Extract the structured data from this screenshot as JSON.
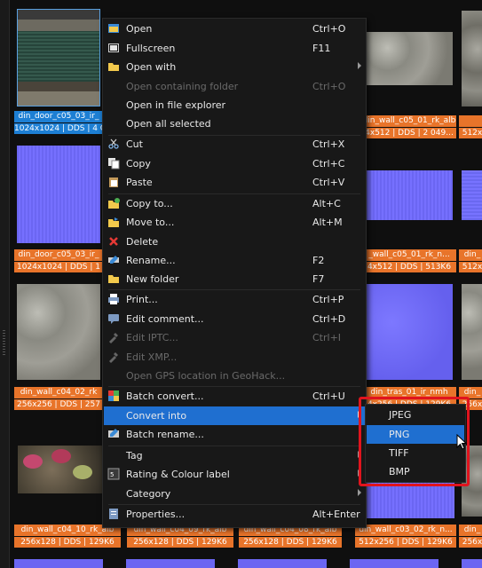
{
  "thumbnails": [
    {
      "name": "din_door_c05_03_ir_",
      "info": "1024x1024 | DDS | 4 C",
      "selected": true
    },
    {
      "name": "din_wall_c05_01_rk_alb",
      "info": "4x512 | DDS | 2 049..."
    },
    {
      "name": "",
      "info": "512x"
    },
    {
      "name": "din_door_c05_03_ir_",
      "info": "1024x1024 | DDS | 1"
    },
    {
      "name": "_wall_c05_01_rk_n...",
      "info": "4x512 | DDS | 513K6"
    },
    {
      "name": "din_",
      "info": "512x"
    },
    {
      "name": "din_wall_c04_02_rk",
      "info": "256x256 | DDS | 257"
    },
    {
      "name": "din_tras_01_ir_nmh",
      "info": "4x256 | DDS | 129K6"
    },
    {
      "name": "din_",
      "info": "256x"
    },
    {
      "name": "din_wall_c04_10_rk_alb",
      "info": "256x128 | DDS | 129K6"
    },
    {
      "name": "din_wall_c04_09_rk_alb",
      "info": "256x128 | DDS | 129K6"
    },
    {
      "name": "din_wall_c04_08_rk_alb",
      "info": "256x128 | DDS | 129K6"
    },
    {
      "name": "din_wall_c03_02_rk_n...",
      "info": "512x256 | DDS | 129K6"
    },
    {
      "name": "din_",
      "info": "256x"
    }
  ],
  "context_menu": [
    {
      "label": "Open",
      "shortcut": "Ctrl+O",
      "icon": "open-icon"
    },
    {
      "label": "Fullscreen",
      "shortcut": "F11",
      "icon": "fullscreen-icon"
    },
    {
      "label": "Open with",
      "shortcut": "",
      "icon": "folder-icon"
    },
    {
      "label": "Open containing folder",
      "shortcut": "Ctrl+O",
      "icon": ""
    },
    {
      "label": "Open in file explorer",
      "shortcut": "",
      "icon": ""
    },
    {
      "label": "Open all selected",
      "shortcut": "",
      "icon": ""
    },
    {
      "label": "Cut",
      "shortcut": "Ctrl+X",
      "icon": "scissors-icon"
    },
    {
      "label": "Copy",
      "shortcut": "Ctrl+C",
      "icon": "copy-icon"
    },
    {
      "label": "Paste",
      "shortcut": "Ctrl+V",
      "icon": "paste-icon"
    },
    {
      "label": "Copy to...",
      "shortcut": "Alt+C",
      "icon": "copy-to-icon"
    },
    {
      "label": "Move to...",
      "shortcut": "Alt+M",
      "icon": "move-to-icon"
    },
    {
      "label": "Delete",
      "shortcut": "",
      "icon": "delete-icon"
    },
    {
      "label": "Rename...",
      "shortcut": "F2",
      "icon": "rename-icon"
    },
    {
      "label": "New folder",
      "shortcut": "F7",
      "icon": "new-folder-icon"
    },
    {
      "label": "Print...",
      "shortcut": "Ctrl+P",
      "icon": "print-icon"
    },
    {
      "label": "Edit comment...",
      "shortcut": "Ctrl+D",
      "icon": "comment-icon"
    },
    {
      "label": "Edit IPTC...",
      "shortcut": "Ctrl+I",
      "icon": "iptc-icon"
    },
    {
      "label": "Edit XMP...",
      "shortcut": "",
      "icon": "xmp-icon"
    },
    {
      "label": "Open GPS location in GeoHack...",
      "shortcut": "",
      "icon": ""
    },
    {
      "label": "Batch convert...",
      "shortcut": "Ctrl+U",
      "icon": "batch-convert-icon"
    },
    {
      "label": "Convert into",
      "shortcut": "",
      "icon": ""
    },
    {
      "label": "Batch rename...",
      "shortcut": "",
      "icon": "batch-rename-icon"
    },
    {
      "label": "Tag",
      "shortcut": "",
      "icon": ""
    },
    {
      "label": "Rating & Colour label",
      "shortcut": "",
      "icon": "rating-icon"
    },
    {
      "label": "Category",
      "shortcut": "",
      "icon": ""
    },
    {
      "label": "Properties...",
      "shortcut": "Alt+Enter",
      "icon": "properties-icon"
    }
  ],
  "convert_submenu": [
    "JPEG",
    "PNG",
    "TIFF",
    "BMP"
  ],
  "colors": {
    "label_orange": "#e8742a",
    "selection_blue": "#1f6fd0",
    "highlight_box": "#e0141e"
  }
}
